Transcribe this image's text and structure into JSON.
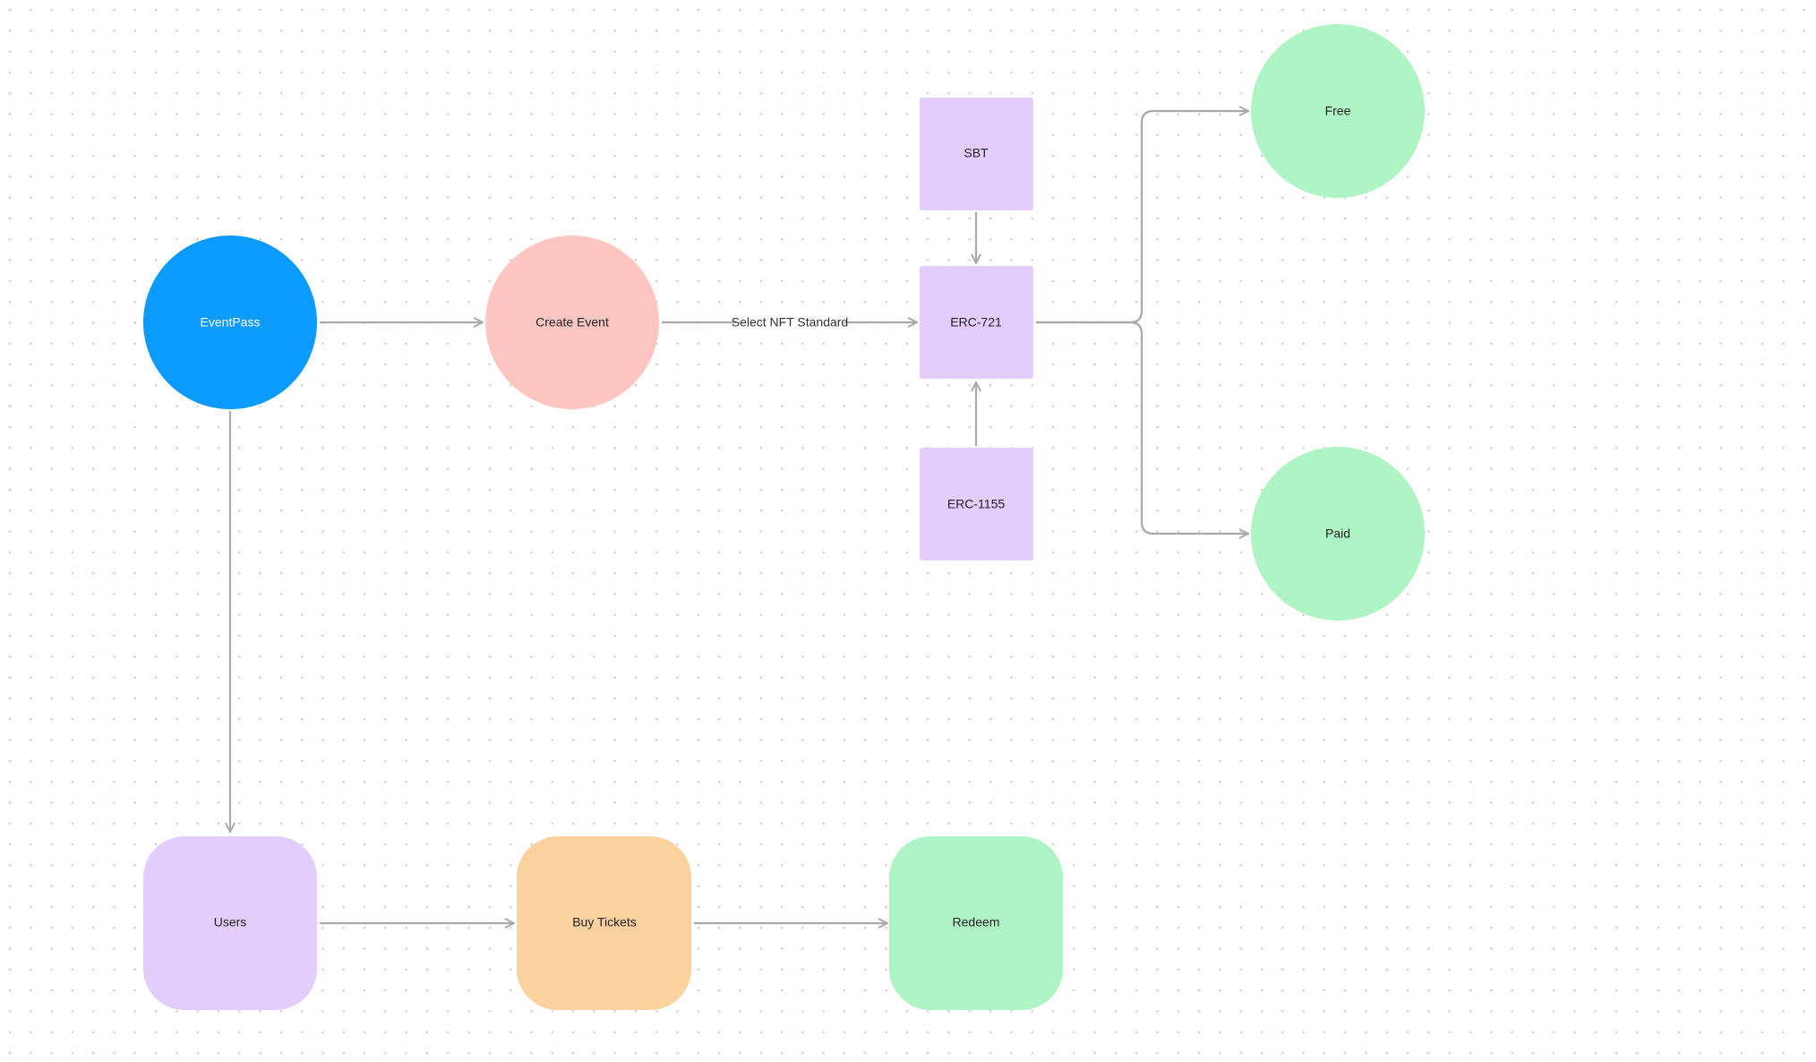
{
  "colors": {
    "blue": "#0b9bfe",
    "pink": "#fdc6c0",
    "purple": "#e3cdfc",
    "green": "#aff4c5",
    "orange": "#fbd19d",
    "edge": "#a9a9a9",
    "grid_dot": "#c8c8c8"
  },
  "nodes": {
    "eventpass": "EventPass",
    "create_event": "Create Event",
    "sbt": "SBT",
    "erc721": "ERC-721",
    "erc1155": "ERC-1155",
    "free": "Free",
    "paid": "Paid",
    "users": "Users",
    "buy_tickets": "Buy Tickets",
    "redeem": "Redeem"
  },
  "edges": {
    "select_nft_standard": "Select NFT Standard"
  }
}
